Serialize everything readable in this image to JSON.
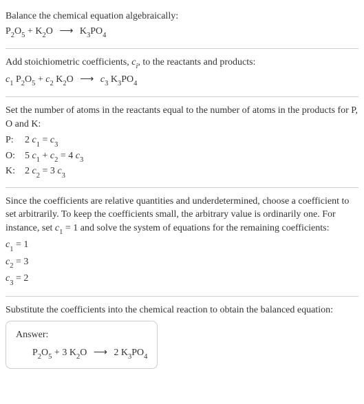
{
  "section1": {
    "title": "Balance the chemical equation algebraically:",
    "equation_lhs1": "P",
    "equation_sub1": "2",
    "equation_mid1": "O",
    "equation_sub2": "5",
    "equation_plus": " + K",
    "equation_sub3": "2",
    "equation_mid2": "O",
    "equation_arrow": "⟶",
    "equation_rhs": "K",
    "equation_sub4": "3",
    "equation_rhs2": "PO",
    "equation_sub5": "4"
  },
  "section2": {
    "intro_a": "Add stoichiometric coefficients, ",
    "intro_ci": "c",
    "intro_ci_sub": "i",
    "intro_b": ", to the reactants and products:",
    "c1": "c",
    "c1sub": "1",
    "sp1": " P",
    "sp1sub1": "2",
    "sp1mid": "O",
    "sp1sub2": "5",
    "plus1": " + ",
    "c2": "c",
    "c2sub": "2",
    "sp2": " K",
    "sp2sub1": "2",
    "sp2mid": "O",
    "arrow": "⟶",
    "c3": "c",
    "c3sub": "3",
    "sp3": " K",
    "sp3sub1": "3",
    "sp3mid": "PO",
    "sp3sub2": "4"
  },
  "section3": {
    "intro": "Set the number of atoms in the reactants equal to the number of atoms in the products for P, O and K:",
    "rows": {
      "p_label": "P:",
      "p_eq_a": "2 ",
      "p_eq_c1": "c",
      "p_eq_c1sub": "1",
      "p_eq_eq": " = ",
      "p_eq_c3": "c",
      "p_eq_c3sub": "3",
      "o_label": "O:",
      "o_eq_a": "5 ",
      "o_eq_c1": "c",
      "o_eq_c1sub": "1",
      "o_eq_plus": " + ",
      "o_eq_c2": "c",
      "o_eq_c2sub": "2",
      "o_eq_eq": " = 4 ",
      "o_eq_c3": "c",
      "o_eq_c3sub": "3",
      "k_label": "K:",
      "k_eq_a": "2 ",
      "k_eq_c2": "c",
      "k_eq_c2sub": "2",
      "k_eq_eq": " = 3 ",
      "k_eq_c3": "c",
      "k_eq_c3sub": "3"
    }
  },
  "section4": {
    "intro_a": "Since the coefficients are relative quantities and underdetermined, choose a coefficient to set arbitrarily. To keep the coefficients small, the arbitrary value is ordinarily one. For instance, set ",
    "intro_c1": "c",
    "intro_c1sub": "1",
    "intro_b": " = 1 and solve the system of equations for the remaining coefficients:",
    "line1_c": "c",
    "line1_sub": "1",
    "line1_val": " = 1",
    "line2_c": "c",
    "line2_sub": "2",
    "line2_val": " = 3",
    "line3_c": "c",
    "line3_sub": "3",
    "line3_val": " = 2"
  },
  "section5": {
    "intro": "Substitute the coefficients into the chemical reaction to obtain the balanced equation:",
    "answer_label": "Answer:",
    "eq_a": "P",
    "eq_sub1": "2",
    "eq_b": "O",
    "eq_sub2": "5",
    "eq_plus": " + 3 K",
    "eq_sub3": "2",
    "eq_c": "O",
    "eq_arrow": "⟶",
    "eq_d": "2 K",
    "eq_sub4": "3",
    "eq_e": "PO",
    "eq_sub5": "4"
  }
}
